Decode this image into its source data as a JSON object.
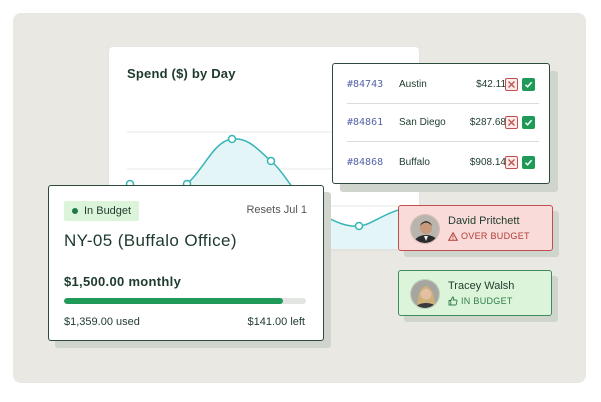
{
  "chart": {
    "title": "Spend ($) by Day",
    "colors": {
      "line": "#36b4b8",
      "fill": "#e3f5f6",
      "grid": "#e6e8e6"
    }
  },
  "transactions": [
    {
      "id": "#84743",
      "city": "Austin",
      "amount": "$42.11"
    },
    {
      "id": "#84861",
      "city": "San Diego",
      "amount": "$287.68"
    },
    {
      "id": "#84868",
      "city": "Buffalo",
      "amount": "$908.14"
    }
  ],
  "budget": {
    "status": "In Budget",
    "resets": "Resets Jul 1",
    "title": "NY-05 (Buffalo Office)",
    "amount": "$1,500.00 monthly",
    "used": "$1,359.00 used",
    "left": "$141.00 left",
    "progress_percent": 90.6
  },
  "people": [
    {
      "name": "David Pritchett",
      "status": "OVER BUDGET",
      "icon": "warning-triangle-icon"
    },
    {
      "name": "Tracey Walsh",
      "status": "IN BUDGET",
      "icon": "thumbs-up-icon"
    }
  ],
  "colors": {
    "stage": "#eae8e3",
    "dark_green": "#1e3a2c",
    "accent_green": "#1f9a58",
    "alert_red": "#c0504d",
    "id_blue": "#5564a8"
  }
}
